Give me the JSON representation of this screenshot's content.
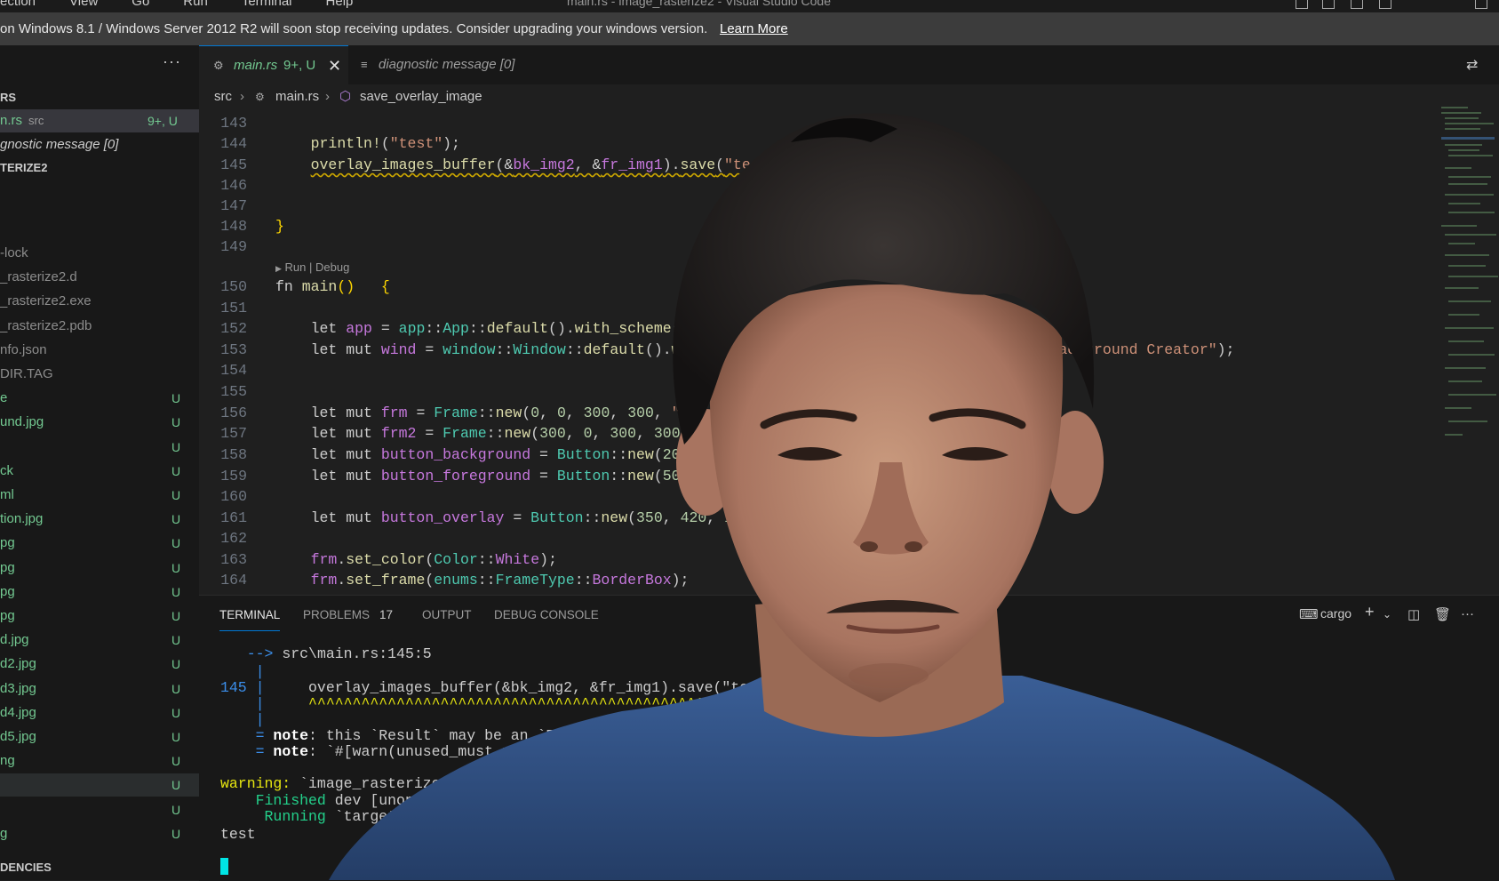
{
  "titlebar": {
    "menu": [
      "ection",
      "View",
      "Go",
      "Run",
      "Terminal",
      "Help"
    ],
    "title": "main.rs - image_rasterize2 - Visual Studio Code"
  },
  "banner": {
    "message": "on Windows 8.1 / Windows Server 2012 R2 will soon stop receiving updates. Consider upgrading your windows version.",
    "link": "Learn More"
  },
  "sidebar": {
    "more": "···",
    "open_editors_header": "RS",
    "open_editors": [
      {
        "name": "n.rs",
        "dir": "src",
        "status": "9+, U"
      },
      {
        "name": "gnostic message [0]"
      }
    ],
    "project_header": "TERIZE2",
    "files": [
      {
        "name": "-lock",
        "status": ""
      },
      {
        "name": "_rasterize2.d",
        "status": ""
      },
      {
        "name": "_rasterize2.exe",
        "status": ""
      },
      {
        "name": "_rasterize2.pdb",
        "status": ""
      },
      {
        "name": "nfo.json",
        "status": ""
      },
      {
        "name": "DIR.TAG",
        "status": ""
      },
      {
        "name": "e",
        "status": "U"
      },
      {
        "name": "und.jpg",
        "status": "U"
      },
      {
        "name": "",
        "status": "U"
      },
      {
        "name": "ck",
        "status": "U"
      },
      {
        "name": "ml",
        "status": "U"
      },
      {
        "name": "tion.jpg",
        "status": "U"
      },
      {
        "name": "pg",
        "status": "U"
      },
      {
        "name": "pg",
        "status": "U"
      },
      {
        "name": "pg",
        "status": "U"
      },
      {
        "name": "pg",
        "status": "U"
      },
      {
        "name": "d.jpg",
        "status": "U"
      },
      {
        "name": "d2.jpg",
        "status": "U"
      },
      {
        "name": "d3.jpg",
        "status": "U"
      },
      {
        "name": "d4.jpg",
        "status": "U"
      },
      {
        "name": "d5.jpg",
        "status": "U"
      },
      {
        "name": "ng",
        "status": "U"
      },
      {
        "name": "",
        "status": "U"
      },
      {
        "name": "",
        "status": "U"
      },
      {
        "name": "g",
        "status": "U"
      }
    ],
    "deps_header": "DENCIES"
  },
  "tabs": [
    {
      "label": "main.rs",
      "badge": "9+, U",
      "close": "✕"
    },
    {
      "label": "diagnostic message [0]"
    }
  ],
  "breadcrumb": [
    "src",
    "main.rs",
    "save_overlay_image"
  ],
  "editor": {
    "codelens": "Run | Debug"
  },
  "panel": {
    "tabs": [
      "TERMINAL",
      "PROBLEMS",
      "OUTPUT",
      "DEBUG CONSOLE"
    ],
    "problems_count": "17",
    "shell": "cargo"
  },
  "icons": [
    "rust-file-icon",
    "text-file-icon",
    "close-icon",
    "compare-icon",
    "chevron-right-icon",
    "symbol-method-icon",
    "terminal-icon",
    "plus-icon",
    "chevron-down-icon",
    "split-icon",
    "trash-icon",
    "more-icon",
    "play-icon"
  ]
}
